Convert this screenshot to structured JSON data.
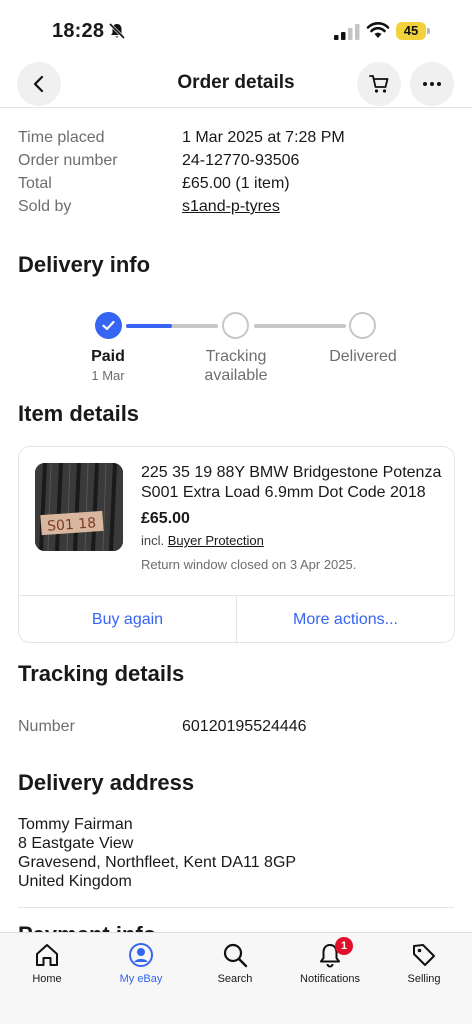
{
  "status_bar": {
    "time": "18:28",
    "battery": "45"
  },
  "header": {
    "title": "Order details"
  },
  "order": {
    "time_placed_label": "Time placed",
    "time_placed": "1 Mar 2025 at 7:28 PM",
    "order_number_label": "Order number",
    "order_number": "24-12770-93506",
    "total_label": "Total",
    "total": "£65.00 (1 item)",
    "sold_by_label": "Sold by",
    "sold_by": "s1and-p-tyres"
  },
  "delivery": {
    "title": "Delivery info",
    "steps": [
      {
        "label": "Paid",
        "sub": "1 Mar",
        "done": true
      },
      {
        "label": "Tracking available",
        "sub": "",
        "done": false
      },
      {
        "label": "Delivered",
        "sub": "",
        "done": false
      }
    ],
    "progress_fraction": 0.25
  },
  "item": {
    "section_title": "Item details",
    "title": "225 35 19 88Y BMW Bridgestone Potenza S001 Extra Load 6.9mm Dot Code 2018",
    "price": "£65.00",
    "incl_prefix": "incl.",
    "incl_link": "Buyer Protection",
    "return_note": "Return window closed on 3 Apr 2025.",
    "buy_again": "Buy again",
    "more_actions": "More actions...",
    "image_tag": "S01 18"
  },
  "tracking": {
    "title": "Tracking details",
    "number_label": "Number",
    "number": "60120195524446"
  },
  "address": {
    "title": "Delivery address",
    "line1": "Tommy Fairman",
    "line2": "8 Eastgate View",
    "line3": "Gravesend, Northfleet, Kent DA11 8GP",
    "line4": "United Kingdom"
  },
  "next_section_partial": "Payment info",
  "nav": {
    "items": [
      {
        "label": "Home",
        "icon": "home-icon"
      },
      {
        "label": "My eBay",
        "icon": "account-icon",
        "active": true
      },
      {
        "label": "Search",
        "icon": "search-icon"
      },
      {
        "label": "Notifications",
        "icon": "bell-icon",
        "badge": "1"
      },
      {
        "label": "Selling",
        "icon": "tag-icon"
      }
    ]
  },
  "colors": {
    "accent": "#3665f3",
    "badge": "#e0102a",
    "battery": "#f2d23a"
  }
}
